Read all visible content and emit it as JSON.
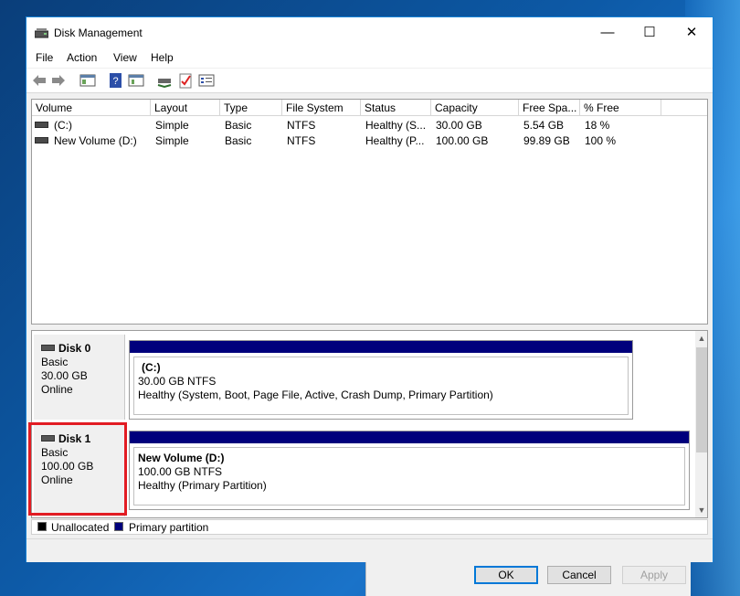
{
  "window": {
    "title": "Disk Management"
  },
  "menu": [
    "File",
    "Action",
    "View",
    "Help"
  ],
  "toolbar_icons": [
    "back-arrow-icon",
    "forward-arrow-icon",
    "show-hide-console-tree-icon",
    "help-icon",
    "properties-icon",
    "rescan-disks-icon",
    "checklist-icon",
    "settings-icon"
  ],
  "columns": [
    "Volume",
    "Layout",
    "Type",
    "File System",
    "Status",
    "Capacity",
    "Free Spa...",
    "% Free"
  ],
  "volumes": [
    {
      "volume": "(C:)",
      "layout": "Simple",
      "type": "Basic",
      "fs": "NTFS",
      "status": "Healthy (S...",
      "capacity": "30.00 GB",
      "free": "5.54 GB",
      "pct": "18 %"
    },
    {
      "volume": "New Volume (D:)",
      "layout": "Simple",
      "type": "Basic",
      "fs": "NTFS",
      "status": "Healthy (P...",
      "capacity": "100.00 GB",
      "free": "99.89 GB",
      "pct": "100 %"
    }
  ],
  "disks": [
    {
      "name": "Disk 0",
      "type": "Basic",
      "size": "30.00 GB",
      "state": "Online",
      "partition": {
        "name": "(C:)",
        "size": "30.00 GB NTFS",
        "status": "Healthy (System, Boot, Page File, Active, Crash Dump, Primary Partition)"
      }
    },
    {
      "name": "Disk 1",
      "type": "Basic",
      "size": "100.00 GB",
      "state": "Online",
      "partition": {
        "name": "New Volume  (D:)",
        "size": "100.00 GB NTFS",
        "status": "Healthy (Primary Partition)"
      }
    }
  ],
  "legend": [
    {
      "label": "Unallocated",
      "color": "#000000"
    },
    {
      "label": "Primary partition",
      "color": "#00007c"
    }
  ],
  "dialog_buttons": {
    "ok": "OK",
    "cancel": "Cancel",
    "apply": "Apply"
  },
  "colors": {
    "partition_bar": "#00007c",
    "highlight": "#e21c23",
    "window_border": "#1883d7"
  }
}
